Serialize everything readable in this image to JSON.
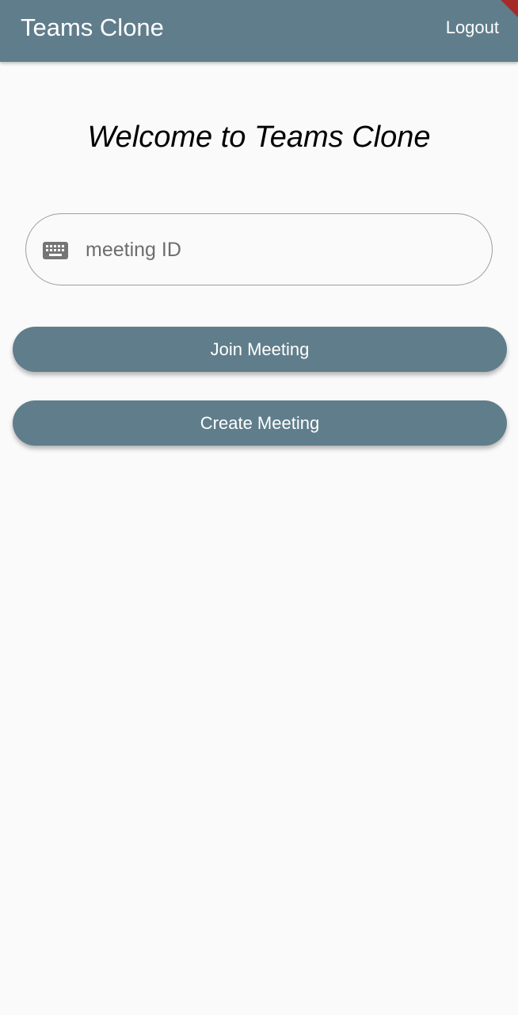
{
  "app_bar": {
    "title": "Teams Clone",
    "logout_label": "Logout",
    "color": "#607d8b"
  },
  "main": {
    "welcome": "Welcome to Teams Clone",
    "meeting_field": {
      "placeholder": "meeting ID",
      "value": "",
      "icon": "keyboard-icon"
    },
    "join_label": "Join Meeting",
    "create_label": "Create Meeting"
  },
  "colors": {
    "primary": "#607d8b",
    "background": "#fafafa",
    "debug_banner": "#a52a2a"
  }
}
